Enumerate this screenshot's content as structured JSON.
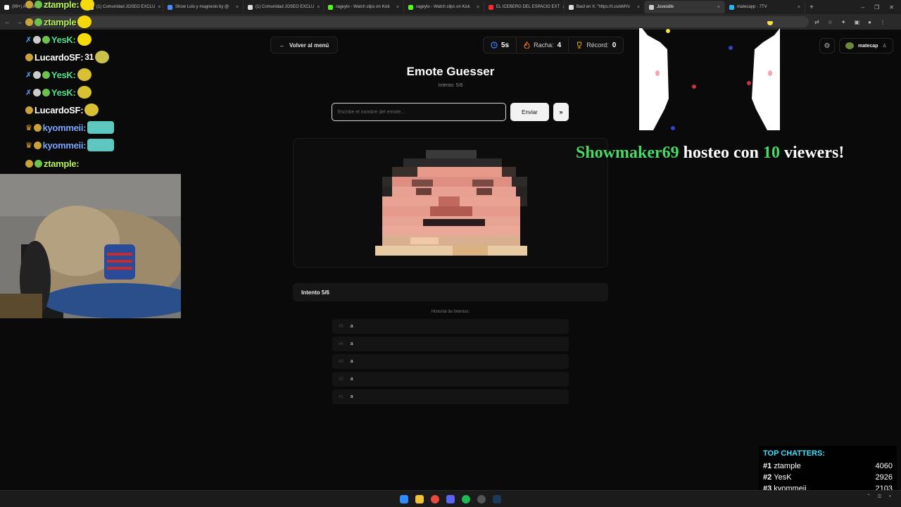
{
  "browser": {
    "tabs": [
      {
        "label": "(99+) A ir torno - whatcore",
        "color": "#ffffff",
        "active": false
      },
      {
        "label": "(1) Comunidad JOSEO EXCLU",
        "color": "#dddddd",
        "active": false
      },
      {
        "label": "Show Lolo y magnesio by @",
        "color": "#4a8cff",
        "active": false
      },
      {
        "label": "(1) Comunidad JOSEO EXCLU",
        "color": "#dddddd",
        "active": false
      },
      {
        "label": "rageylo - Watch clips on Kick",
        "color": "#53fc18",
        "active": false
      },
      {
        "label": "rageylo - Watch clips on Kick",
        "color": "#53fc18",
        "active": false
      },
      {
        "label": "EL ICEBERG DEL ESPACIO EXT",
        "color": "#ff2a2a",
        "active": false
      },
      {
        "label": "Baúl en X: \"https://t.co/eMYv",
        "color": "#dddddd",
        "active": false
      },
      {
        "label": "Joseodle",
        "color": "#cccccc",
        "active": true
      },
      {
        "label": "matecapp - 7TV",
        "color": "#29b6f6",
        "active": false
      }
    ]
  },
  "header": {
    "back_label": "Volver al menú",
    "timer_value": "5s",
    "streak_label": "Racha:",
    "streak_value": "4",
    "record_label": "Récord:",
    "record_value": "0",
    "username": "matecap"
  },
  "game": {
    "title": "Emote Guesser",
    "subtitle": "Intento: 5/6",
    "input_placeholder": "Escribe el nombre del emote...",
    "send_label": "Enviar",
    "skip_label": "»",
    "attempt_label": "Intento 5/6",
    "history_label": "Historial de intentos:",
    "history": [
      {
        "num": "#5",
        "value": "a"
      },
      {
        "num": "#4",
        "value": "a"
      },
      {
        "num": "#3",
        "value": "a"
      },
      {
        "num": "#2",
        "value": "a"
      },
      {
        "num": "#1",
        "value": "a"
      }
    ]
  },
  "chat": [
    {
      "user": "ztample:",
      "color": "#b7f25a",
      "msg": ""
    },
    {
      "user": "ztample",
      "color": "#b7f25a",
      "msg": ""
    },
    {
      "user": "YesK:",
      "color": "#51e08a",
      "msg": ""
    },
    {
      "user": "LucardoSF:",
      "color": "#ffffff",
      "msg": "31"
    },
    {
      "user": "YesK:",
      "color": "#51e08a",
      "msg": ""
    },
    {
      "user": "YesK:",
      "color": "#51e08a",
      "msg": ""
    },
    {
      "user": "LucardoSF:",
      "color": "#ffffff",
      "msg": ""
    },
    {
      "user": "kyommeii:",
      "color": "#7aa8ff",
      "msg": ""
    },
    {
      "user": "kyommeii:",
      "color": "#7aa8ff",
      "msg": ""
    },
    {
      "user": "ztample:",
      "color": "#b7f25a",
      "msg": ""
    }
  ],
  "host_alert": {
    "host": "Showmaker69",
    "middle": "hosteo con",
    "count": "10",
    "end": "viewers!"
  },
  "top_chatters": {
    "heading": "TOP CHATTERS:",
    "rows": [
      {
        "rank": "#1",
        "name": "ztample",
        "count": "4060"
      },
      {
        "rank": "#2",
        "name": "YesK",
        "count": "2926"
      },
      {
        "rank": "#3",
        "name": "kyommeii",
        "count": "2103"
      }
    ]
  },
  "colors": {
    "accent_green": "#4bd966",
    "chatters_heading": "#41e1ff",
    "timer_icon": "#4a7cff",
    "streak_icon": "#ff7a1a",
    "record_icon": "#e0b000"
  }
}
